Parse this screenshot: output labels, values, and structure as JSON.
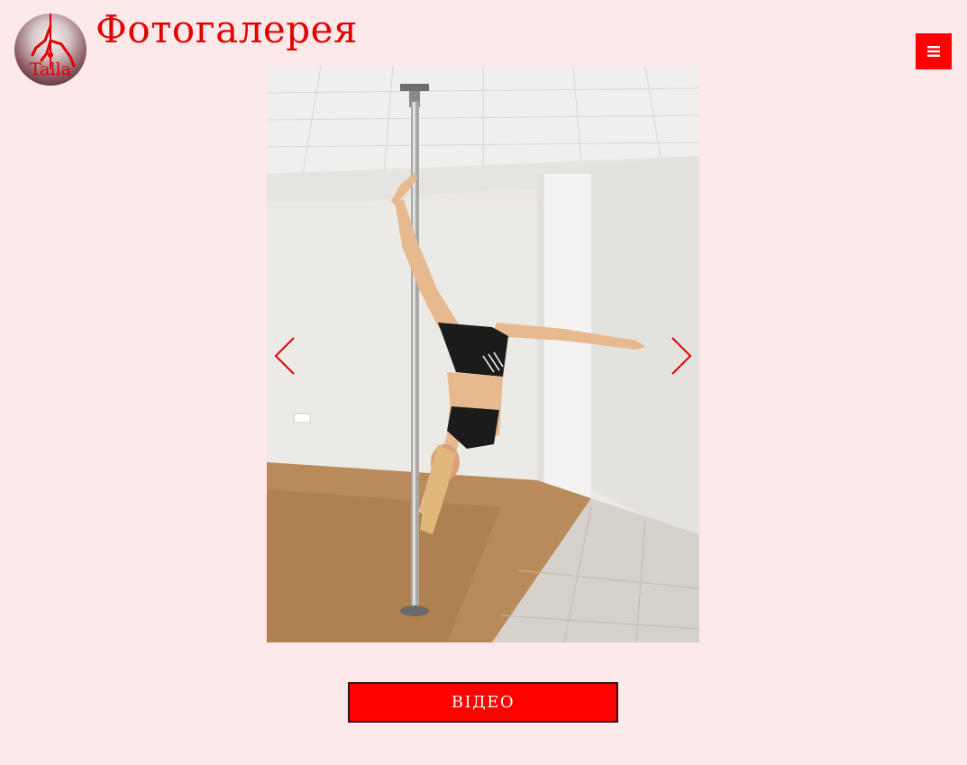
{
  "header": {
    "logo_text": "Talla",
    "title": "Фотогалерея",
    "menu_icon": "hamburger-icon"
  },
  "gallery": {
    "prev_icon": "chevron-left-icon",
    "next_icon": "chevron-right-icon"
  },
  "video_button": {
    "label": "ВІДЕО"
  },
  "colors": {
    "background": "#fde9ea",
    "accent": "#ff0000",
    "title": "#e00000"
  }
}
